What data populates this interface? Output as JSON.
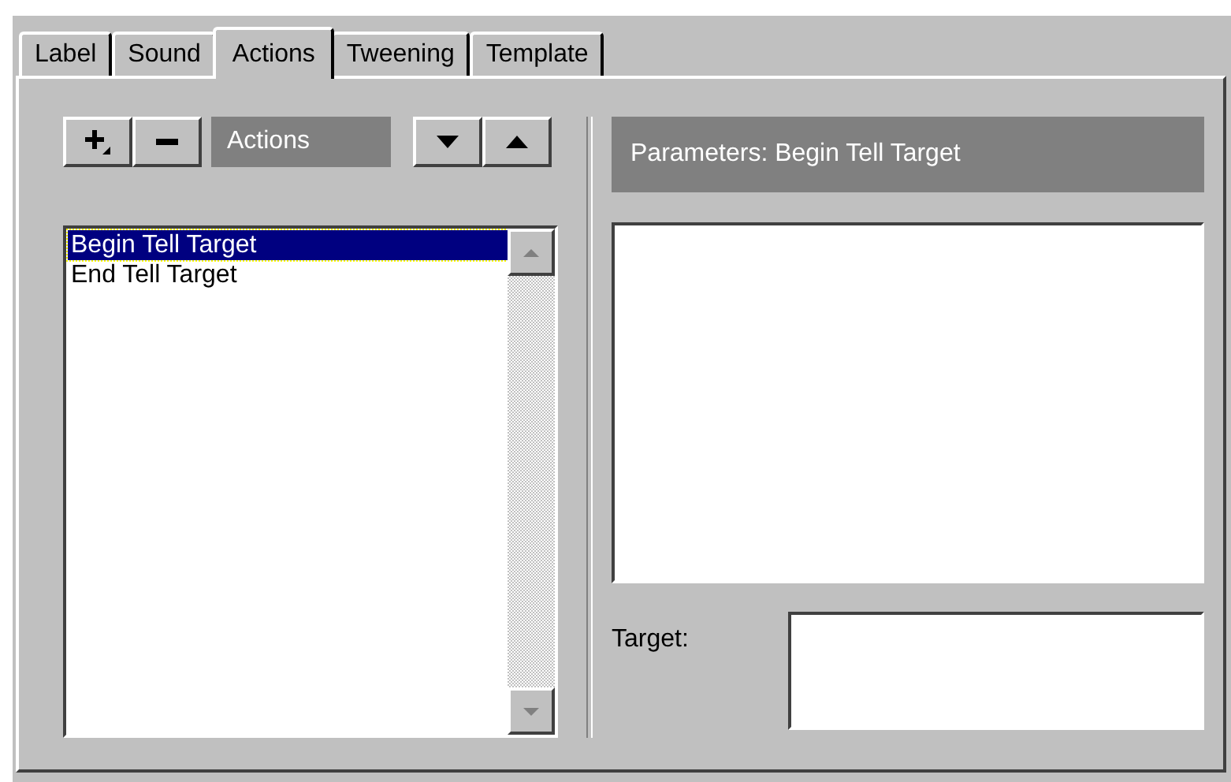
{
  "tabs": [
    {
      "label": "Label",
      "selected": false
    },
    {
      "label": "Sound",
      "selected": false
    },
    {
      "label": "Actions",
      "selected": true
    },
    {
      "label": "Tweening",
      "selected": false
    },
    {
      "label": "Template",
      "selected": false
    }
  ],
  "actions_label": "Actions",
  "actions_list": {
    "items": [
      {
        "label": "Begin Tell Target",
        "selected": true
      },
      {
        "label": "End Tell Target",
        "selected": false
      }
    ]
  },
  "parameters_header": "Parameters: Begin Tell Target",
  "target": {
    "label": "Target:"
  }
}
